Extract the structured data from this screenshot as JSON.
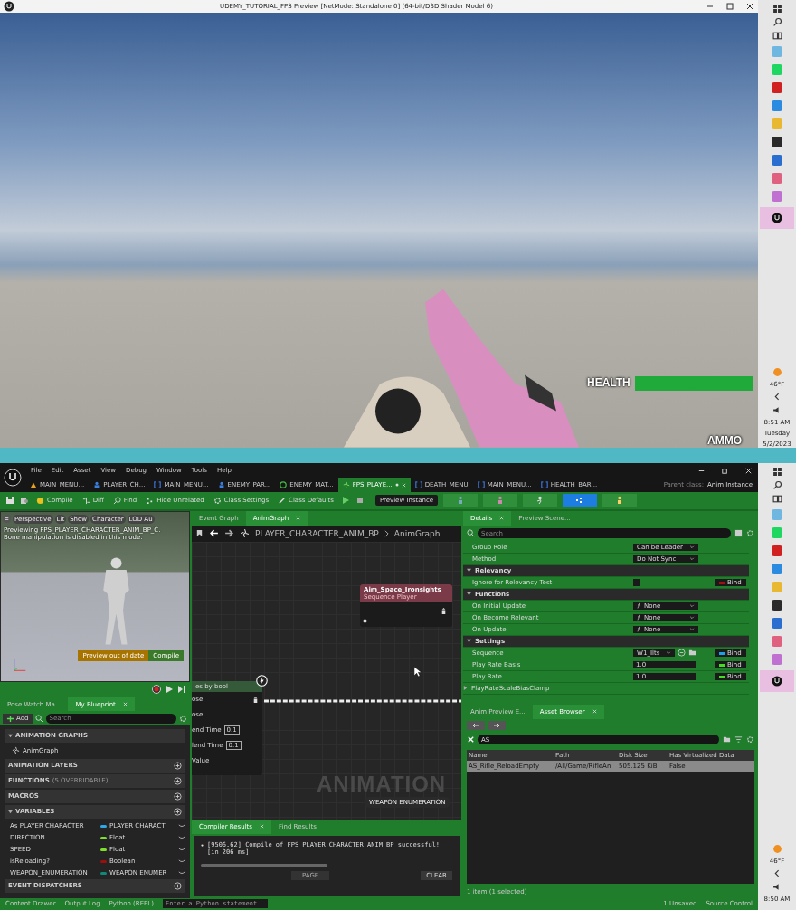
{
  "game_window": {
    "title": "UDEMY_TUTORIAL_FPS Preview [NetMode: Standalone 0]  (64-bit/D3D Shader Model 6)",
    "health_label": "HEALTH",
    "health": {
      "level": 1.0
    },
    "ammo_label": "AMMO"
  },
  "taskbars": [
    {
      "apps": [
        {
          "kind": "app",
          "color": "#6fb6e0",
          "selected": false
        },
        {
          "kind": "app",
          "color": "#1ed760",
          "selected": false
        },
        {
          "kind": "app",
          "color": "#d02020",
          "selected": false
        },
        {
          "kind": "app",
          "color": "#2b8be0",
          "selected": false
        },
        {
          "kind": "app",
          "color": "#e8b830",
          "selected": false
        },
        {
          "kind": "app",
          "color": "#2a2a2a",
          "selected": false
        },
        {
          "kind": "app",
          "color": "#2a6fd0",
          "selected": false
        },
        {
          "kind": "app",
          "color": "#e06080",
          "selected": false
        },
        {
          "kind": "app",
          "color": "#c070d0",
          "selected": false
        },
        {
          "kind": "unreal",
          "color": "#111111",
          "selected": true
        }
      ],
      "weather": "46°F",
      "time": "8:51 AM",
      "day": "Tuesday",
      "date": "5/2/2023"
    },
    {
      "apps": [
        {
          "kind": "app",
          "color": "#6fb6e0",
          "selected": false
        },
        {
          "kind": "app",
          "color": "#1ed760",
          "selected": false
        },
        {
          "kind": "app",
          "color": "#d02020",
          "selected": false
        },
        {
          "kind": "app",
          "color": "#2b8be0",
          "selected": false
        },
        {
          "kind": "app",
          "color": "#e8b830",
          "selected": false
        },
        {
          "kind": "app",
          "color": "#2a2a2a",
          "selected": false
        },
        {
          "kind": "app",
          "color": "#2a6fd0",
          "selected": false
        },
        {
          "kind": "app",
          "color": "#e06080",
          "selected": false
        },
        {
          "kind": "app",
          "color": "#c070d0",
          "selected": false
        },
        {
          "kind": "unreal",
          "color": "#111111",
          "selected": true
        }
      ],
      "weather": "46°F",
      "time": "8:50 AM"
    }
  ],
  "editor": {
    "menu": [
      "File",
      "Edit",
      "Asset",
      "View",
      "Debug",
      "Window",
      "Tools",
      "Help"
    ],
    "tabs": [
      {
        "label": "MAIN_MENU...",
        "kind": "level",
        "selected": false,
        "modified": false
      },
      {
        "label": "PLAYER_CH...",
        "kind": "character",
        "selected": false,
        "modified": false
      },
      {
        "label": "MAIN_MENU...",
        "kind": "widget",
        "selected": false,
        "modified": false
      },
      {
        "label": "ENEMY_PAR...",
        "kind": "character",
        "selected": false,
        "modified": false
      },
      {
        "label": "ENEMY_MAT...",
        "kind": "material",
        "selected": false,
        "modified": false
      },
      {
        "label": "FPS_PLAYE...",
        "kind": "anim",
        "selected": true,
        "modified": true
      },
      {
        "label": "DEATH_MENU",
        "kind": "widget",
        "selected": false,
        "modified": false
      },
      {
        "label": "MAIN_MENU...",
        "kind": "widget",
        "selected": false,
        "modified": false
      },
      {
        "label": "HEALTH_BAR...",
        "kind": "widget",
        "selected": false,
        "modified": false
      }
    ],
    "parent_class_label": "Parent class:",
    "parent_class": "Anim Instance",
    "toolbar": [
      {
        "kind": "compile",
        "label": "Compile"
      },
      {
        "kind": "diff",
        "label": "Diff"
      },
      {
        "kind": "find",
        "label": "Find"
      },
      {
        "kind": "hide",
        "label": "Hide Unrelated"
      },
      {
        "kind": "settings",
        "label": "Class Settings"
      },
      {
        "kind": "defaults",
        "label": "Class Defaults"
      }
    ],
    "preview_instance": "Preview Instance",
    "modes": [
      {
        "kind": "skeleton",
        "selected": false
      },
      {
        "kind": "mesh",
        "selected": false
      },
      {
        "kind": "animation",
        "selected": false
      },
      {
        "kind": "blueprint",
        "selected": true
      },
      {
        "kind": "physics",
        "selected": false
      }
    ],
    "viewport": {
      "buttons": [
        "Perspective",
        "Lit",
        "Show",
        "Character",
        "LOD Au"
      ],
      "overlay": [
        "Previewing FPS_PLAYER_CHARACTER_ANIM_BP_C.",
        "Bone manipulation is disabled in this mode."
      ],
      "status": "Preview out of date",
      "compile": "Compile"
    },
    "blueprint_tabs": [
      {
        "label": "Pose Watch Ma...",
        "selected": false
      },
      {
        "label": "My Blueprint",
        "selected": true
      }
    ],
    "add": "Add",
    "search_placeholder": "Search",
    "sections": [
      {
        "title": "ANIMATION GRAPHS",
        "expanded": true,
        "items": [
          "AnimGraph"
        ]
      },
      {
        "title": "ANIMATION LAYERS",
        "expanded": false
      },
      {
        "title": "FUNCTIONS",
        "note": "(5 OVERRIDABLE)",
        "expanded": false
      },
      {
        "title": "MACROS",
        "expanded": false
      },
      {
        "title": "VARIABLES",
        "expanded": true,
        "variables": [
          {
            "name": "As PLAYER CHARACTER",
            "type": "PLAYER CHARACT",
            "color": "#2fa8e8"
          },
          {
            "name": "DIRECTION",
            "type": "Float",
            "color": "#7fe02a"
          },
          {
            "name": "SPEED",
            "type": "Float",
            "color": "#7fe02a"
          },
          {
            "name": "isReloading?",
            "type": "Boolean",
            "color": "#9a1010"
          },
          {
            "name": "WEAPON_ENUMERATION",
            "type": "WEAPON ENUMER",
            "color": "#0e8a78"
          }
        ]
      },
      {
        "title": "EVENT DISPATCHERS",
        "expanded": false
      }
    ],
    "graph_tabs": [
      {
        "label": "Event Graph",
        "selected": false
      },
      {
        "label": "AnimGraph",
        "selected": true
      }
    ],
    "breadcrumb": [
      "PLAYER_CHARACTER_ANIM_BP",
      "AnimGraph"
    ],
    "graph": {
      "sequence_node": {
        "title": "Aim_Space_Ironsights",
        "subtitle": "Sequence Player"
      },
      "blend_node": {
        "title": "es by bool",
        "pins": [
          {
            "label": "ose"
          },
          {
            "label": "ose"
          },
          {
            "label": "end Time",
            "value": "0.1"
          },
          {
            "label": "lend Time",
            "value": "0.1"
          },
          {
            "label": "Value"
          }
        ]
      },
      "watermark": "ANIMATION",
      "enum_node": "WEAPON ENUMERATION"
    },
    "compiler_tabs": [
      {
        "label": "Compiler Results",
        "selected": true
      },
      {
        "label": "Find Results",
        "selected": false
      }
    ],
    "compiler_message": "[9506.62] Compile of FPS_PLAYER_CHARACTER_ANIM_BP successful! [in 206 ms]",
    "page": "PAGE",
    "clear": "CLEAR",
    "details_search_placeholder": "Search",
    "details_tabs": [
      {
        "label": "Details",
        "selected": true
      },
      {
        "label": "Preview Scene...",
        "selected": false
      }
    ],
    "details_rows": [
      {
        "kind": "dropdown",
        "label": "Group Role",
        "value": "Can be Leader"
      },
      {
        "kind": "dropdown",
        "label": "Method",
        "value": "Do Not Sync"
      },
      {
        "kind": "section",
        "label": "Relevancy",
        "expanded": true
      },
      {
        "kind": "checkbox",
        "label": "Ignore for Relevancy Test",
        "checked": false,
        "bind": "Bind",
        "color": "#a01010"
      },
      {
        "kind": "section",
        "label": "Functions",
        "expanded": true
      },
      {
        "kind": "function",
        "label": "On Initial Update",
        "value": "None"
      },
      {
        "kind": "function",
        "label": "On Become Relevant",
        "value": "None"
      },
      {
        "kind": "function",
        "label": "On Update",
        "value": "None"
      },
      {
        "kind": "section",
        "label": "Settings",
        "expanded": true
      },
      {
        "kind": "asset",
        "label": "Sequence",
        "value": "W1_Ilts",
        "bind": "Bind",
        "color": "#1ea0e6"
      },
      {
        "kind": "number",
        "label": "Play Rate Basis",
        "value": "1.0",
        "bind": "Bind",
        "color": "#44dd22"
      },
      {
        "kind": "number",
        "label": "Play Rate",
        "value": "1.0",
        "bind": "Bind",
        "color": "#44dd22"
      },
      {
        "kind": "group",
        "label": "PlayRateScaleBiasClamp",
        "expanded": false
      }
    ],
    "asset_tabs": [
      {
        "label": "Anim Preview E...",
        "selected": false
      },
      {
        "label": "Asset Browser",
        "selected": true
      }
    ],
    "asset_search": "AS",
    "asset_columns": [
      "Name",
      "Path",
      "Disk Size",
      "Has Virtualized Data"
    ],
    "asset_rows": [
      {
        "name": "AS_Rifle_ReloadEmpty",
        "path": "/All/Game/RifleAn",
        "size": "505.125 KiB",
        "virtualized": "False",
        "selected": true
      }
    ],
    "asset_footer": "1 item (1 selected)",
    "status_bar": {
      "content_drawer": "Content Drawer",
      "output_log": "Output Log",
      "python": "Python (REPL)",
      "python_placeholder": "Enter a Python statement",
      "unsaved": "1 Unsaved",
      "source_control": "Source Control"
    }
  }
}
